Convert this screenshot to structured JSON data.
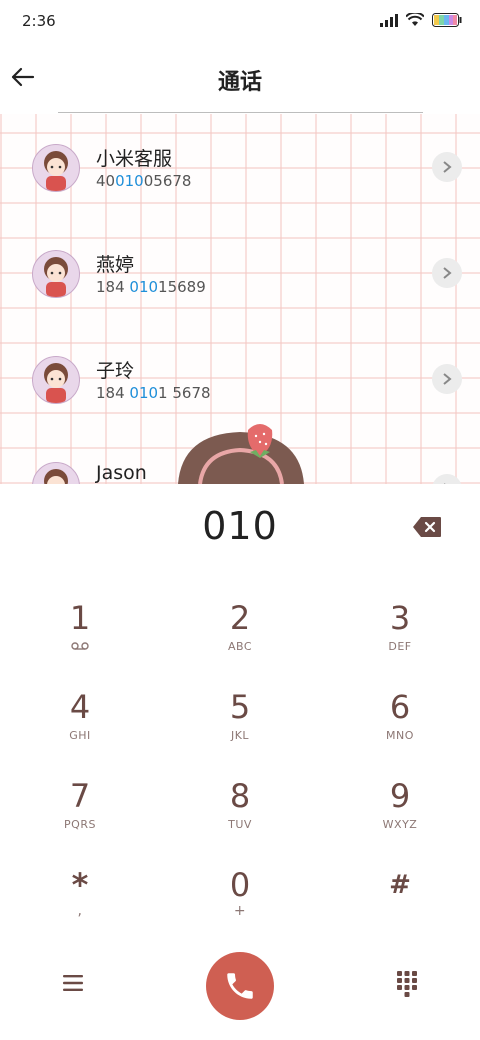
{
  "status": {
    "time": "2:36"
  },
  "header": {
    "title": "通话"
  },
  "contacts": [
    {
      "name": "小米客服",
      "num_pre": "40",
      "num_hl": "010",
      "num_post": "05678"
    },
    {
      "name": "燕婷",
      "num_pre": "184 ",
      "num_hl": "010",
      "num_post": "15689"
    },
    {
      "name": "子玲",
      "num_pre": "184 ",
      "num_hl": "010",
      "num_post": "1 5678"
    },
    {
      "name": "Jason",
      "num_pre": "",
      "num_hl": "",
      "num_post": ""
    }
  ],
  "dialer": {
    "entered": "010",
    "keys": [
      {
        "digit": "1",
        "letters": ""
      },
      {
        "digit": "2",
        "letters": "ABC"
      },
      {
        "digit": "3",
        "letters": "DEF"
      },
      {
        "digit": "4",
        "letters": "GHI"
      },
      {
        "digit": "5",
        "letters": "JKL"
      },
      {
        "digit": "6",
        "letters": "MNO"
      },
      {
        "digit": "7",
        "letters": "PQRS"
      },
      {
        "digit": "8",
        "letters": "TUV"
      },
      {
        "digit": "9",
        "letters": "WXYZ"
      },
      {
        "digit": "*",
        "letters": ","
      },
      {
        "digit": "0",
        "letters": "+"
      },
      {
        "digit": "#",
        "letters": ""
      }
    ]
  },
  "colors": {
    "call": "#cf5f52",
    "highlight": "#1f8fd9",
    "key_text": "#6a4a45",
    "grid": "#f4c8c4"
  },
  "icons": [
    "back-arrow-icon",
    "voicemail-icon",
    "delete-icon",
    "menu-icon",
    "phone-icon",
    "keypad-icon",
    "chevron-right-icon"
  ]
}
